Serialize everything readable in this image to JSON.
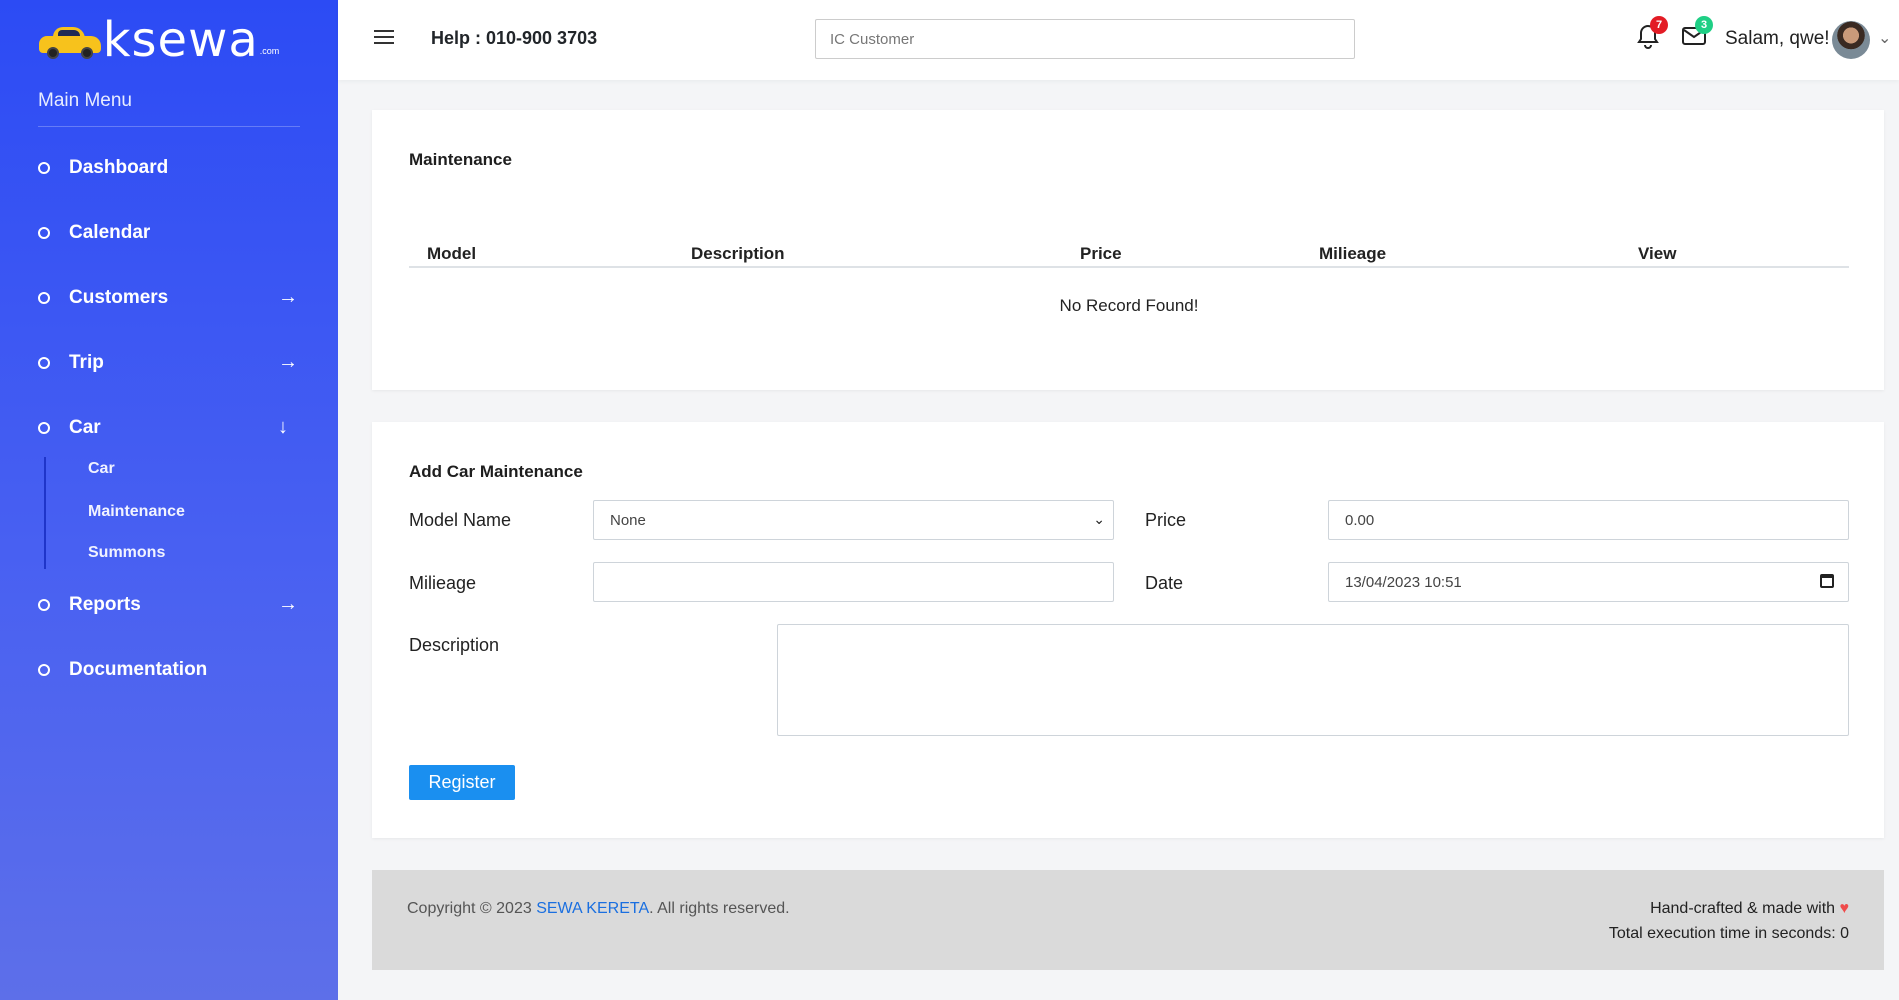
{
  "brand": {
    "logo_text": "ksewa",
    "logo_suffix": ".com"
  },
  "sidebar": {
    "menu_title": "Main Menu",
    "items": [
      {
        "label": "Dashboard",
        "arrow": ""
      },
      {
        "label": "Calendar",
        "arrow": ""
      },
      {
        "label": "Customers",
        "arrow": "→"
      },
      {
        "label": "Trip",
        "arrow": "→"
      },
      {
        "label": "Car",
        "arrow": "↓"
      },
      {
        "label": "Reports",
        "arrow": "→"
      },
      {
        "label": "Documentation",
        "arrow": ""
      }
    ],
    "car_submenu": [
      "Car",
      "Maintenance",
      "Summons"
    ]
  },
  "header": {
    "help": "Help : 010-900 3703",
    "search_placeholder": "IC Customer",
    "notifications_count": "7",
    "messages_count": "3",
    "user_greeting": "Salam, qwe!"
  },
  "maintenance": {
    "title": "Maintenance",
    "columns": [
      "Model",
      "Description",
      "Price",
      "Milieage",
      "View"
    ],
    "empty_message": "No Record Found!"
  },
  "form": {
    "title": "Add Car Maintenance",
    "model_label": "Model Name",
    "model_value": "None",
    "price_label": "Price",
    "price_value": "0.00",
    "mileage_label": "Milieage",
    "mileage_value": "",
    "date_label": "Date",
    "date_value": "13/04/2023 10:51",
    "description_label": "Description",
    "register_label": "Register"
  },
  "footer": {
    "copyright_prefix": "Copyright © 2023 ",
    "company": "SEWA KERETA",
    "copyright_suffix": ". All rights reserved.",
    "handcrafted": "Hand-crafted & made with",
    "execution": "Total execution time in seconds: 0"
  },
  "colors": {
    "accent": "#2c4bf4",
    "button": "#1a8ff0",
    "badge_red": "#e31c25",
    "badge_green": "#1fcf85"
  }
}
